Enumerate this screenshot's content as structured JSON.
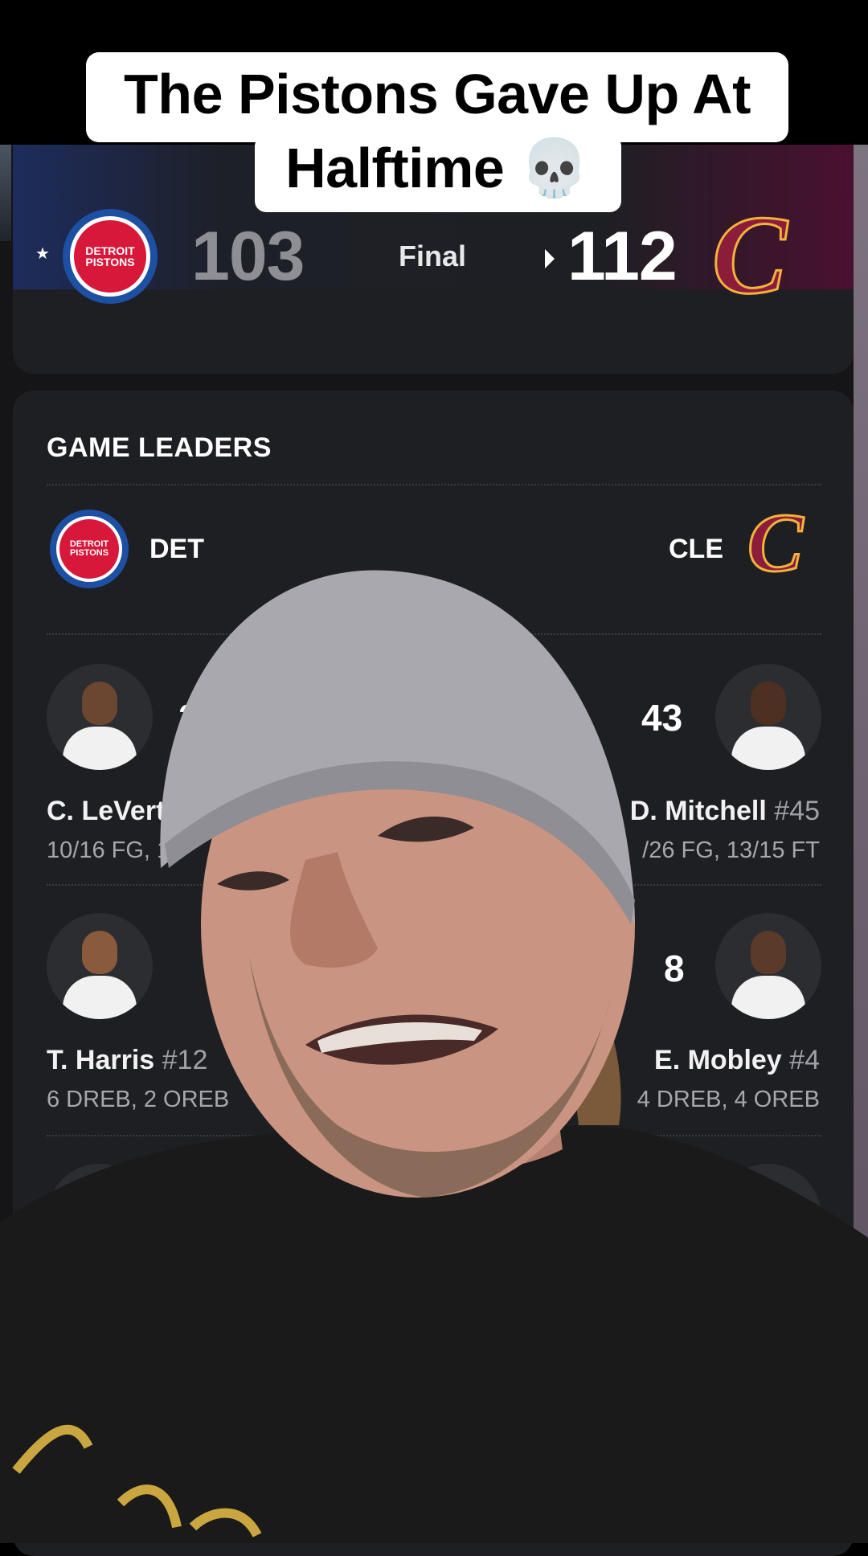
{
  "caption": {
    "line1": "The Pistons Gave Up At",
    "line2": "Halftime 💀"
  },
  "scoreboard": {
    "away": {
      "logo_text_1": "DETROIT",
      "logo_text_2": "PISTONS",
      "score": "103",
      "winner": false
    },
    "status": "Final",
    "home": {
      "logo_letter": "C",
      "score": "112",
      "winner": true
    },
    "colors": {
      "pistons_blue": "#1d4fa3",
      "pistons_red": "#d8183b",
      "cavs_wine": "#8b1d3b",
      "cavs_gold": "#f2b23c"
    }
  },
  "leaders": {
    "title": "GAME LEADERS",
    "away_abbr": "DET",
    "home_abbr": "CLE",
    "rows": [
      {
        "away": {
          "stat": "2",
          "name": "C. LeVert",
          "line": "10/16 FG, 1"
        },
        "home": {
          "stat": "43",
          "name": "D. Mitchell",
          "number": "#45",
          "line": "/26 FG, 13/15 FT"
        }
      },
      {
        "away": {
          "name": "T. Harris",
          "number": "#12",
          "line": "6 DREB, 2 OREB"
        },
        "home": {
          "stat": "8",
          "name": "E. Mobley",
          "number": "#4",
          "line": "4 DREB, 4 OREB"
        }
      }
    ]
  }
}
